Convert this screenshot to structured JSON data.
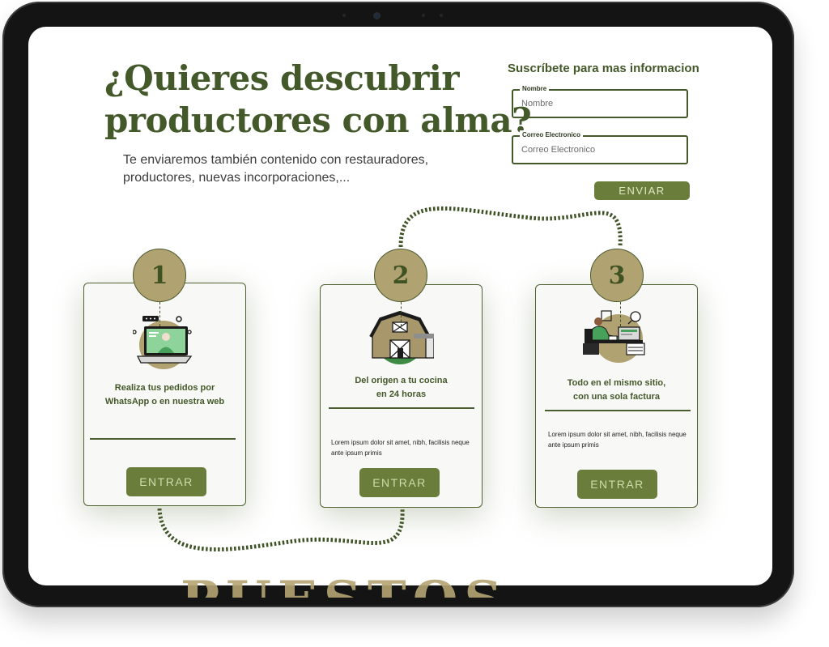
{
  "hero": {
    "title_line1": "¿Quieres descubrir",
    "title_line2": "productores con alma?",
    "subtitle": "Te enviaremos también contenido con restauradores, productores, nuevas incorporaciones,..."
  },
  "subscribe": {
    "title": "Suscríbete para mas informacion",
    "fields": [
      {
        "label": "Nombre",
        "placeholder": "Nombre",
        "value": ""
      },
      {
        "label": "Correo Electronico",
        "placeholder": "Correo Electronico",
        "value": ""
      }
    ],
    "submit_label": "ENVIAR"
  },
  "steps": [
    {
      "number": "1",
      "title_line1": "Realiza tus pedidos por",
      "title_line2": "WhatsApp o en nuestra web",
      "body": "",
      "button_label": "ENTRAR",
      "illustration": "laptop-video-call-icon"
    },
    {
      "number": "2",
      "title_line1": "Del origen a tu cocina",
      "title_line2": "en 24 horas",
      "body": "Lorem ipsum dolor sit amet, nibh, facilisis neque ante ipsum primis",
      "button_label": "ENTRAR",
      "illustration": "barn-icon"
    },
    {
      "number": "3",
      "title_line1": "Todo en el mismo sitio,",
      "title_line2": "con una sola factura",
      "body": "Lorem ipsum dolor sit amet, nibh, facilisis neque ante ipsum primis",
      "button_label": "ENTRAR",
      "illustration": "office-desk-icon"
    }
  ],
  "footer_peek": {
    "text": "PUESTOS DE"
  },
  "colors": {
    "brand_green": "#44592a",
    "button_green": "#6a7d3b",
    "khaki": "#b1a271",
    "device_frame": "#141414"
  }
}
